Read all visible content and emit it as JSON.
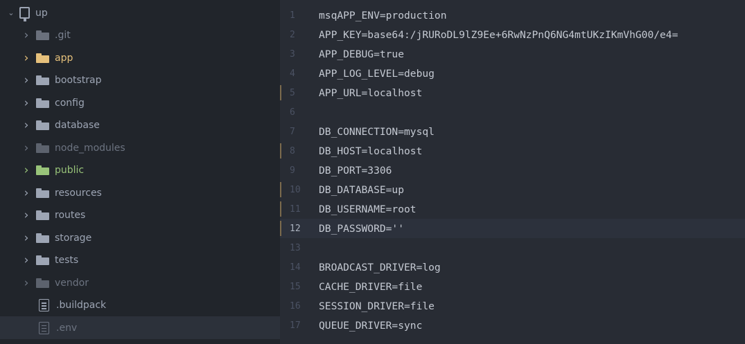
{
  "tree": {
    "root": {
      "label": "up",
      "icon": "repo-icon"
    },
    "items": [
      {
        "label": ".git",
        "type": "folder",
        "color": "#7b8291",
        "icon_color": "#6a707c"
      },
      {
        "label": "app",
        "type": "folder",
        "color": "#e5c07b",
        "icon_color": "#e5c07b"
      },
      {
        "label": "bootstrap",
        "type": "folder",
        "color": "#9da5b4",
        "icon_color": "#9da5b4"
      },
      {
        "label": "config",
        "type": "folder",
        "color": "#9da5b4",
        "icon_color": "#9da5b4"
      },
      {
        "label": "database",
        "type": "folder",
        "color": "#9da5b4",
        "icon_color": "#9da5b4"
      },
      {
        "label": "node_modules",
        "type": "folder",
        "color": "#6c7380",
        "icon_color": "#5c626d"
      },
      {
        "label": "public",
        "type": "folder",
        "color": "#98c379",
        "icon_color": "#98c379"
      },
      {
        "label": "resources",
        "type": "folder",
        "color": "#9da5b4",
        "icon_color": "#9da5b4"
      },
      {
        "label": "routes",
        "type": "folder",
        "color": "#9da5b4",
        "icon_color": "#9da5b4"
      },
      {
        "label": "storage",
        "type": "folder",
        "color": "#9da5b4",
        "icon_color": "#9da5b4"
      },
      {
        "label": "tests",
        "type": "folder",
        "color": "#9da5b4",
        "icon_color": "#9da5b4"
      },
      {
        "label": "vendor",
        "type": "folder",
        "color": "#6c7380",
        "icon_color": "#5c626d"
      },
      {
        "label": ".buildpack",
        "type": "file",
        "color": "#9da5b4",
        "icon_color": "#9da5b4"
      },
      {
        "label": ".env",
        "type": "file",
        "color": "#6c7380",
        "icon_color": "#6c7380",
        "selected": true
      }
    ]
  },
  "editor": {
    "cursor_line": 12,
    "modified_lines": [
      5,
      8,
      10,
      11,
      12
    ],
    "lines": [
      {
        "num": "1",
        "text": "msqAPP_ENV=production"
      },
      {
        "num": "2",
        "text": "APP_KEY=base64:/jRURoDL9lZ9Ee+6RwNzPnQ6NG4mtUKzIKmVhG00/e4="
      },
      {
        "num": "3",
        "text": "APP_DEBUG=true"
      },
      {
        "num": "4",
        "text": "APP_LOG_LEVEL=debug"
      },
      {
        "num": "5",
        "text": "APP_URL=localhost"
      },
      {
        "num": "6",
        "text": ""
      },
      {
        "num": "7",
        "text": "DB_CONNECTION=mysql"
      },
      {
        "num": "8",
        "text": "DB_HOST=localhost"
      },
      {
        "num": "9",
        "text": "DB_PORT=3306"
      },
      {
        "num": "10",
        "text": "DB_DATABASE=up"
      },
      {
        "num": "11",
        "text": "DB_USERNAME=root"
      },
      {
        "num": "12",
        "text": "DB_PASSWORD=''"
      },
      {
        "num": "13",
        "text": ""
      },
      {
        "num": "14",
        "text": "BROADCAST_DRIVER=log"
      },
      {
        "num": "15",
        "text": "CACHE_DRIVER=file"
      },
      {
        "num": "16",
        "text": "SESSION_DRIVER=file"
      },
      {
        "num": "17",
        "text": "QUEUE_DRIVER=sync"
      }
    ]
  }
}
